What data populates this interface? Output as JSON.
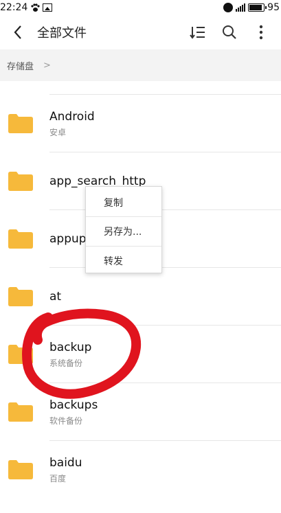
{
  "status_bar": {
    "time": "22:24",
    "battery_level": "95",
    "icons": [
      "paw-icon",
      "image-icon",
      "alarm-icon",
      "signal-icon",
      "battery-icon"
    ]
  },
  "header": {
    "title": "全部文件",
    "icons": [
      "back-icon",
      "sort-icon",
      "search-icon",
      "more-icon"
    ]
  },
  "breadcrumb": {
    "root": "存储盘",
    "separator": ">"
  },
  "files": [
    {
      "name": "Android",
      "subtitle": "安卓"
    },
    {
      "name": "app_search_http",
      "subtitle": ""
    },
    {
      "name": "appup",
      "subtitle": ""
    },
    {
      "name": "at",
      "subtitle": ""
    },
    {
      "name": "backup",
      "subtitle": "系统备份"
    },
    {
      "name": "backups",
      "subtitle": "软件备份"
    },
    {
      "name": "baidu",
      "subtitle": "百度"
    }
  ],
  "context_menu": {
    "items": [
      "复制",
      "另存为...",
      "转发"
    ]
  },
  "colors": {
    "folder": "#f6b93b",
    "annotation": "#e0141e",
    "breadcrumb_bg": "#f3f3f3"
  }
}
